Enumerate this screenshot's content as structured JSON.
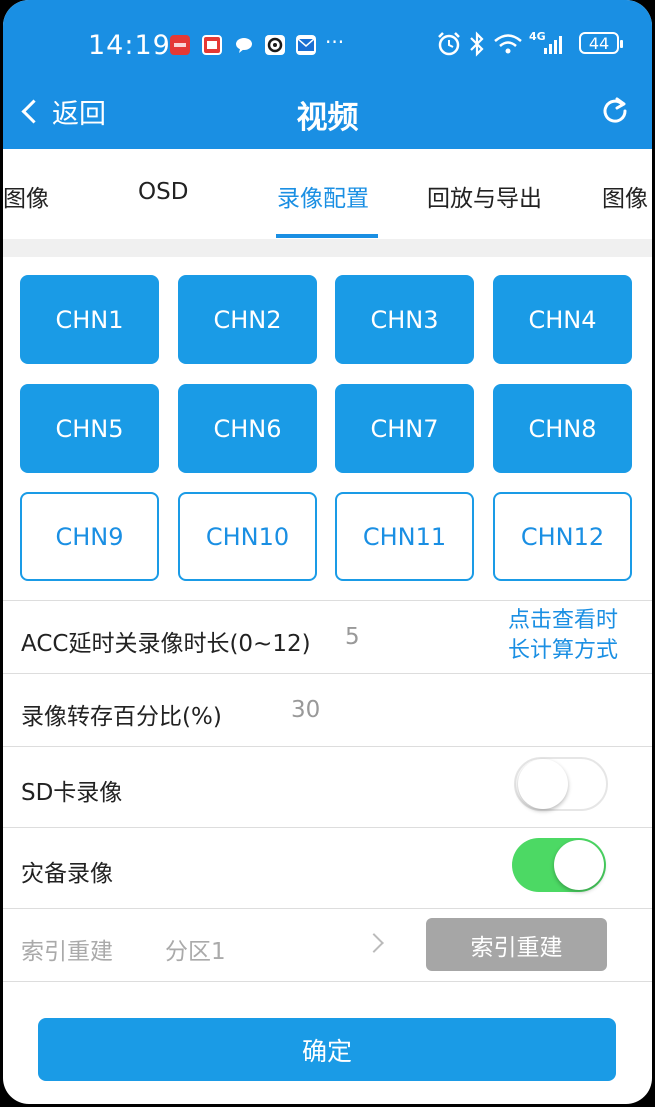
{
  "status_bar": {
    "time": "14:19",
    "more": "···",
    "network": "4G",
    "battery": "44",
    "notification_icons": [
      "huawei-app-icon",
      "red-app-icon",
      "chat-bubble-icon",
      "camera-app-icon",
      "mail-icon"
    ],
    "right_icons": [
      "alarm-icon",
      "bluetooth-icon",
      "wifi-icon",
      "signal-icon",
      "battery-icon"
    ]
  },
  "header": {
    "back_label": "返回",
    "title": "视频",
    "refresh_icon": "refresh-icon"
  },
  "tabs": [
    {
      "label": "图像",
      "active": false
    },
    {
      "label": "OSD",
      "active": false
    },
    {
      "label": "录像配置",
      "active": true
    },
    {
      "label": "回放与导出",
      "active": false
    },
    {
      "label": "图像",
      "active": false
    }
  ],
  "channels": [
    {
      "label": "CHN1",
      "selected": true
    },
    {
      "label": "CHN2",
      "selected": true
    },
    {
      "label": "CHN3",
      "selected": true
    },
    {
      "label": "CHN4",
      "selected": true
    },
    {
      "label": "CHN5",
      "selected": true
    },
    {
      "label": "CHN6",
      "selected": true
    },
    {
      "label": "CHN7",
      "selected": true
    },
    {
      "label": "CHN8",
      "selected": true
    },
    {
      "label": "CHN9",
      "selected": false
    },
    {
      "label": "CHN10",
      "selected": false
    },
    {
      "label": "CHN11",
      "selected": false
    },
    {
      "label": "CHN12",
      "selected": false
    }
  ],
  "settings": {
    "acc_delay": {
      "label": "ACC延时关录像时长(0~12)",
      "value": "5",
      "link": "点击查看时长计算方式"
    },
    "transfer_percent": {
      "label": "录像转存百分比(%)",
      "value": "30"
    },
    "sd_record": {
      "label": "SD卡录像",
      "enabled": false
    },
    "backup_record": {
      "label": "灾备录像",
      "enabled": true
    },
    "index_rebuild": {
      "label": "索引重建",
      "partition": "分区1",
      "button": "索引重建"
    }
  },
  "confirm_label": "确定",
  "colors": {
    "primary": "#1a8fe3",
    "toggle_on": "#4cd964",
    "disabled_button": "#a6a6a6"
  }
}
